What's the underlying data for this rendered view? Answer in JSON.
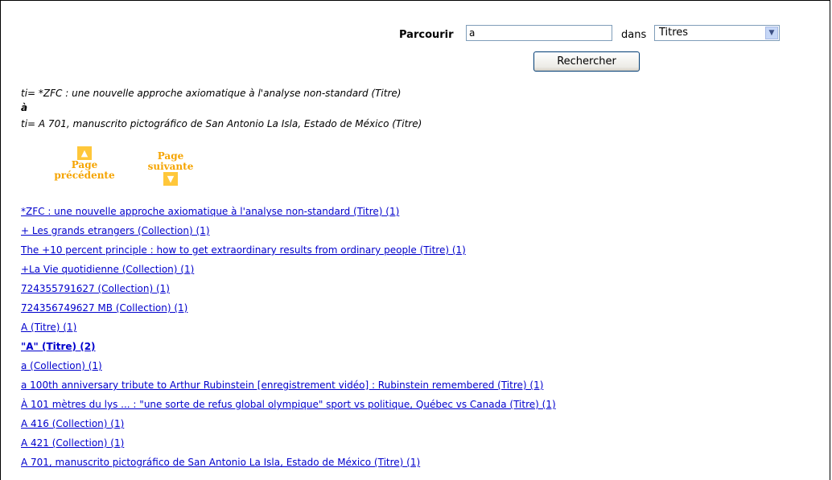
{
  "search": {
    "browse_label": "Parcourir",
    "query_value": "a",
    "in_label": "dans",
    "scope_value": "Titres",
    "scope_arrow": "▼",
    "button_label": "Rechercher"
  },
  "range": {
    "from": "ti= *ZFC : une nouvelle approche axiomatique à l'analyse non-standard (Titre)",
    "to_word": "à",
    "to": "ti= A 701, manuscrito pictográfico de San Antonio La Isla, Estado de México (Titre)"
  },
  "pager": {
    "prev_icon": "arrow-up-icon",
    "prev_label_1": "Page",
    "prev_label_2": "précédente",
    "next_icon": "arrow-down-icon",
    "next_label_1": "Page",
    "next_label_2": "suivante"
  },
  "results": [
    {
      "text": "*ZFC : une nouvelle approche axiomatique à l'analyse non-standard (Titre) (1)"
    },
    {
      "text": "+ Les grands etrangers (Collection) (1)"
    },
    {
      "text": "The +10 percent principle : how to get extraordinary results from ordinary people (Titre) (1)"
    },
    {
      "text": "+La Vie quotidienne (Collection) (1)"
    },
    {
      "text": "724355791627 (Collection) (1)"
    },
    {
      "text": "724356749627 MB (Collection) (1)"
    },
    {
      "text": "A (Titre) (1)"
    },
    {
      "text": "\"A\" (Titre) (2)"
    },
    {
      "text": "a (Collection) (1)"
    },
    {
      "text": "a 100th anniversary tribute to Arthur Rubinstein [enregistrement vidéo] : Rubinstein remembered (Titre) (1)"
    },
    {
      "text": "À 101 mètres du lys ... : \"une sorte de refus global olympique\" sport vs politique, Québec vs Canada (Titre) (1)"
    },
    {
      "text": "A 416 (Collection) (1)"
    },
    {
      "text": "A 421 (Collection) (1)"
    },
    {
      "text": "A 701, manuscrito pictográfico de San Antonio La Isla, Estado de México (Titre) (1)"
    }
  ],
  "colors": {
    "link": "#0000cc",
    "pager_accent": "#f5a400"
  }
}
